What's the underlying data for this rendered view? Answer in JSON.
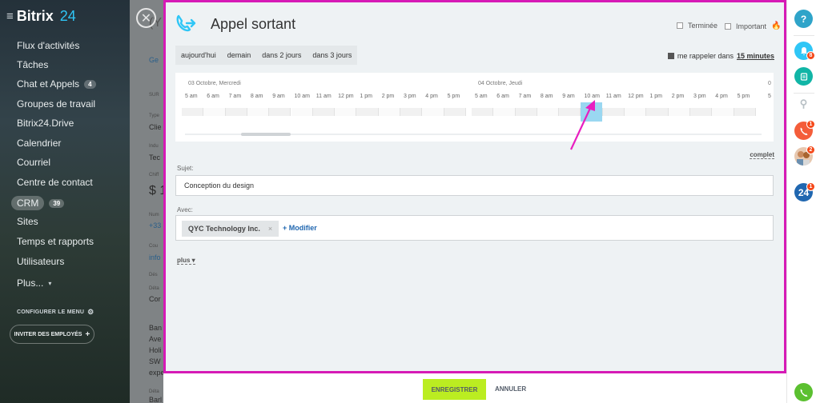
{
  "sidebar": {
    "brand": "Bitrix",
    "brand_num": "24",
    "items": [
      {
        "label": "Flux d'activités"
      },
      {
        "label": "Tâches"
      },
      {
        "label": "Chat et Appels",
        "count": "4"
      },
      {
        "label": "Groupes de travail"
      },
      {
        "label": "Bitrix24.Drive"
      },
      {
        "label": "Calendrier"
      },
      {
        "label": "Courriel"
      },
      {
        "label": "Centre de contact"
      },
      {
        "label": "CRM",
        "count": "39"
      },
      {
        "label": "Sites"
      },
      {
        "label": "Temps et rapports"
      },
      {
        "label": "Utilisateurs"
      },
      {
        "label": "Plus..."
      }
    ],
    "configure_menu": "CONFIGURER LE MENU",
    "invite": "INVITER DES EMPLOYÉS"
  },
  "bgpage": {
    "lines": [
      "(Y",
      "Ge",
      "SUR",
      "Type",
      "Clie",
      "Indu",
      "Tec",
      "Chiff",
      "$ 1",
      "Num",
      "+33",
      "Cou",
      "info",
      "Dés",
      "Déta",
      "Cor",
      "Ban",
      "Ave",
      "Holi",
      "SW",
      "expe",
      "Déta",
      "Barl"
    ]
  },
  "panel": {
    "title": "Appel sortant",
    "terminee": "Terminée",
    "important": "Important",
    "quick_dates": [
      "aujourd'hui",
      "demain",
      "dans 2 jours",
      "dans 3 jours"
    ],
    "remind_text": "me rappeler dans",
    "remind_value": "15 minutes",
    "timeline": {
      "day1": "03 Octobre, Mercredi",
      "day2": "04 Octobre, Jeudi",
      "day3": "0",
      "hours": [
        "5 am",
        "6 am",
        "7 am",
        "8 am",
        "9 am",
        "10 am",
        "11 am",
        "12 pm",
        "1 pm",
        "2 pm",
        "3 pm",
        "4 pm",
        "5 pm"
      ],
      "trailing_hour": "5"
    },
    "complet": "complet",
    "subject_label": "Sujet:",
    "subject_value": "Conception du design",
    "with_label": "Avec:",
    "with_tag": "QYC Technology Inc.",
    "tag_remove": "×",
    "modifier": "+ Modifier",
    "plus": "plus ▾"
  },
  "footer": {
    "save": "ENREGISTRER",
    "cancel": "ANNULER"
  },
  "rail": {
    "help": "?",
    "notifications_count": "8",
    "calls_count": "1",
    "chat_count": "2",
    "b24_count": "1",
    "b24_label": "24"
  },
  "colors": {
    "accent_blue": "#2fc6f6",
    "highlight_border": "#d61ab6",
    "save_green": "#bbed21",
    "notif_red": "#f54819",
    "slot_blue": "#9ad7f1"
  }
}
